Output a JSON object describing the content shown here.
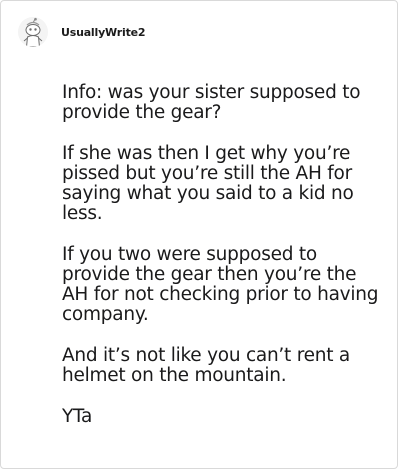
{
  "comment": {
    "username": "UsuallyWrite2",
    "avatar_icon": "snoo-avatar-icon",
    "paragraphs": [
      "Info: was your sister supposed to provide the gear?",
      "If she was then I get why you’re pissed but you’re still the AH for saying what you said to a kid no less.",
      "If you two were supposed to provide the gear then you’re the AH for not checking prior to having company.",
      "And it’s not like you can’t rent a helmet on the mountain.",
      "YTa"
    ]
  },
  "colors": {
    "text": "#1a1a1b",
    "border": "#d9d9d9",
    "avatar_bg": "#f4f4f4",
    "avatar_accent": "#7a7a7a"
  }
}
